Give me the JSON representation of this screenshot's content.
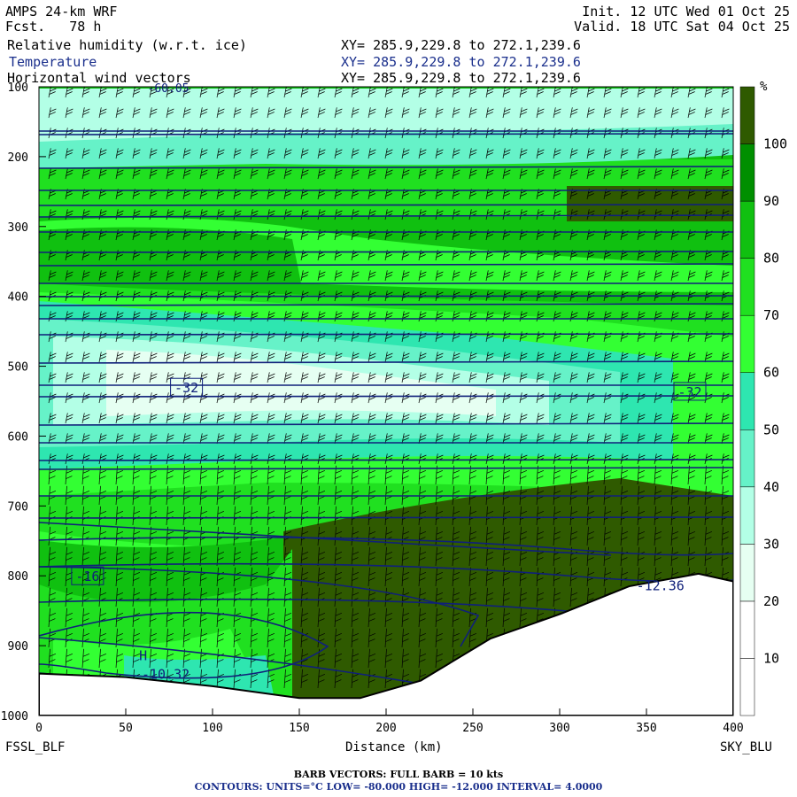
{
  "header": {
    "model": "AMPS 24-km WRF",
    "fcst": "Fcst.   78 h",
    "init": "Init. 12 UTC Wed 01 Oct 25",
    "valid": "Valid. 18 UTC Sat 04 Oct 25",
    "fields": [
      {
        "name": "Relative humidity (w.r.t. ice)",
        "xy": "XY= 285.9,229.8 to 272.1,239.6"
      },
      {
        "name": "Temperature",
        "xy": "XY= 285.9,229.8 to 272.1,239.6"
      },
      {
        "name": "Horizontal wind vectors",
        "xy": "XY= 285.9,229.8 to 272.1,239.6"
      }
    ]
  },
  "chart_data": {
    "type": "heatmap",
    "xlabel": "Distance (km)",
    "x_start_label": "FSSL_BLF",
    "x_end_label": "SKY_BLU",
    "xlim": [
      0,
      400
    ],
    "ylim": [
      1000,
      100
    ],
    "x_ticks": [
      0,
      50,
      100,
      150,
      200,
      250,
      300,
      350,
      400
    ],
    "y_ticks": [
      100,
      200,
      300,
      400,
      500,
      600,
      700,
      800,
      900,
      1000
    ],
    "colorbar": {
      "unit": "%",
      "ticks": [
        10,
        20,
        30,
        40,
        50,
        60,
        70,
        80,
        90,
        100
      ],
      "colors": [
        "#ffffff",
        "#ffffff",
        "#e6fff2",
        "#b3ffe6",
        "#66f2c8",
        "#2ee6b0",
        "#33ff33",
        "#20e020",
        "#10c010",
        "#008f00",
        "#2f5a00"
      ]
    },
    "contour_labels": [
      {
        "text": "-32",
        "x": 85,
        "p": 530
      },
      {
        "text": "-32",
        "x": 375,
        "p": 536
      },
      {
        "text": "-16",
        "x": 28,
        "p": 800
      },
      {
        "text": "-12.36",
        "x": 358,
        "p": 813
      },
      {
        "text": "H",
        "x": 60,
        "p": 913
      },
      {
        "text": "-10.32",
        "x": 73,
        "p": 940
      }
    ],
    "top_label": "-60.05",
    "terrain_km": [
      0,
      50,
      100,
      150,
      185,
      220,
      260,
      300,
      340,
      380,
      400
    ],
    "terrain_hpa": [
      940,
      945,
      958,
      975,
      975,
      950,
      890,
      855,
      815,
      797,
      808
    ]
  },
  "footer": {
    "barbs": "BARB VECTORS:  FULL BARB = 10 kts",
    "contours": "CONTOURS:  UNITS=°C  LOW= -80.000       HIGH= -12.000       INTERVAL=   4.0000"
  }
}
